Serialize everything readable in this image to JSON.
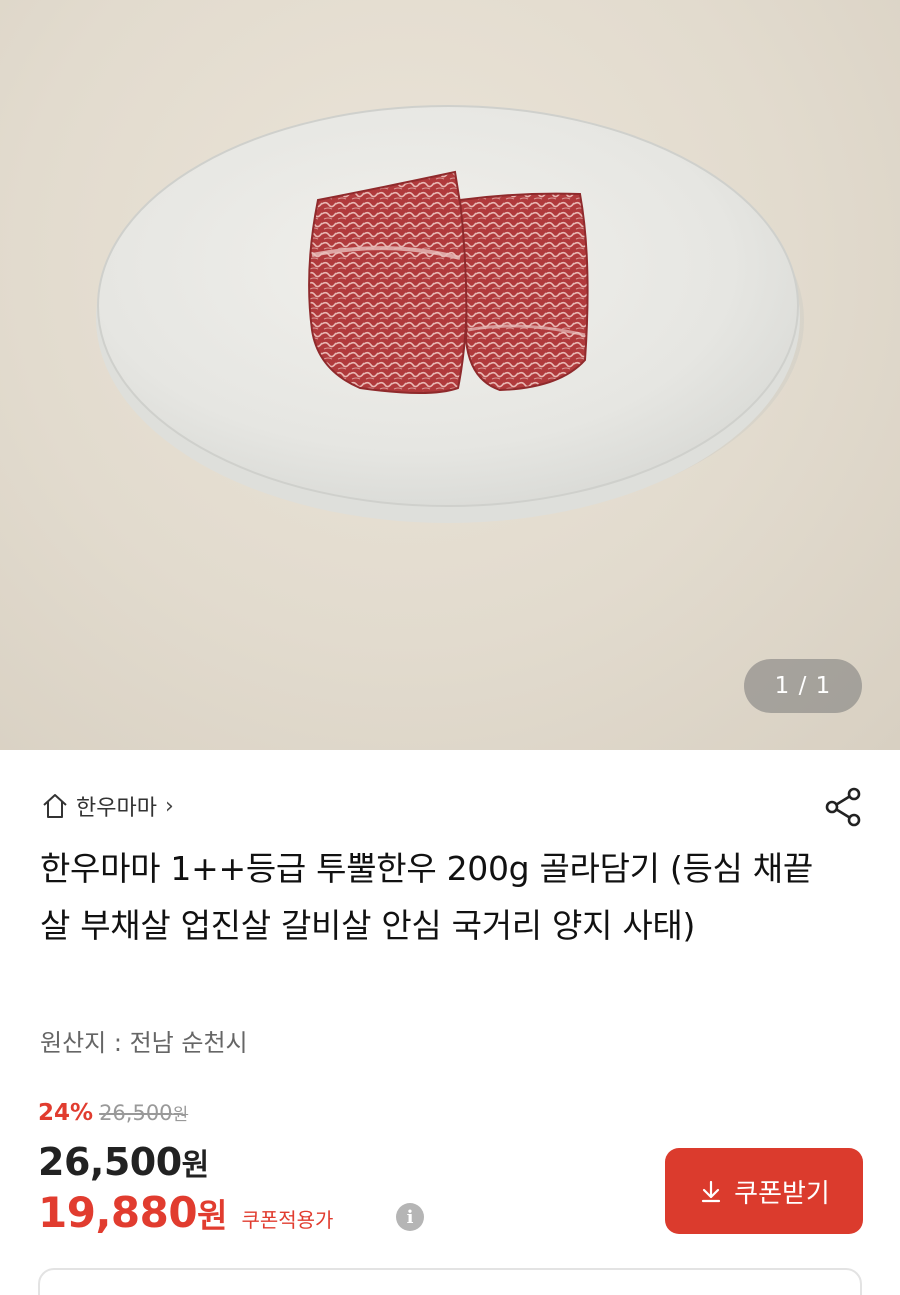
{
  "gallery": {
    "pager": "1 / 1",
    "image_alt": "product-photo-beef-on-plate"
  },
  "store": {
    "name": "한우마마",
    "chevron": "›"
  },
  "product": {
    "title": "한우마마 1++등급 투뿔한우 200g 골라담기 (등심 채끝살 부채살 업진살 갈비살 안심 국거리 양지 사태)",
    "origin": "원산지 : 전남 순천시"
  },
  "pricing": {
    "discount_rate": "24%",
    "original_price": "26,500",
    "original_unit": "원",
    "price": "26,500",
    "price_unit": "원",
    "coupon_price": "19,880",
    "coupon_unit": "원",
    "coupon_label": "쿠폰적용가",
    "info_glyph": "i"
  },
  "actions": {
    "coupon_button_label": "쿠폰받기"
  },
  "colors": {
    "accent": "#db3b2d",
    "sale_text": "#e13c2f",
    "background": "#ffffff"
  },
  "icons": [
    "home-icon",
    "share-icon",
    "download-icon",
    "info-icon",
    "chevron-right-icon"
  ]
}
